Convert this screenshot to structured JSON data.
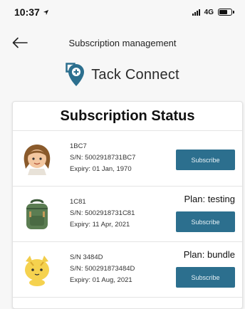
{
  "status_bar": {
    "time": "10:37",
    "network": "4G"
  },
  "nav": {
    "title": "Subscription management"
  },
  "brand": {
    "name": "Tack Connect",
    "accent": "#2c6f8e"
  },
  "card": {
    "title": "Subscription Status"
  },
  "devices": [
    {
      "name": "1BC7",
      "serial": "S/N: 5002918731BC7",
      "expiry": "Expiry: 01 Jan, 1970",
      "plan": "",
      "button": "Subscribe",
      "avatar": "girl-avatar-icon"
    },
    {
      "name": "1C81",
      "serial": "S/N: 5002918731C81",
      "expiry": "Expiry: 11 Apr, 2021",
      "plan": "Plan: testing",
      "button": "Subscribe",
      "avatar": "backpack-avatar-icon"
    },
    {
      "name": "S/N 3484D",
      "serial": "S/N: 500291873484D",
      "expiry": "Expiry: 01 Aug, 2021",
      "plan": "Plan: bundle",
      "button": "Subscribe",
      "avatar": "cat-avatar-icon"
    }
  ]
}
